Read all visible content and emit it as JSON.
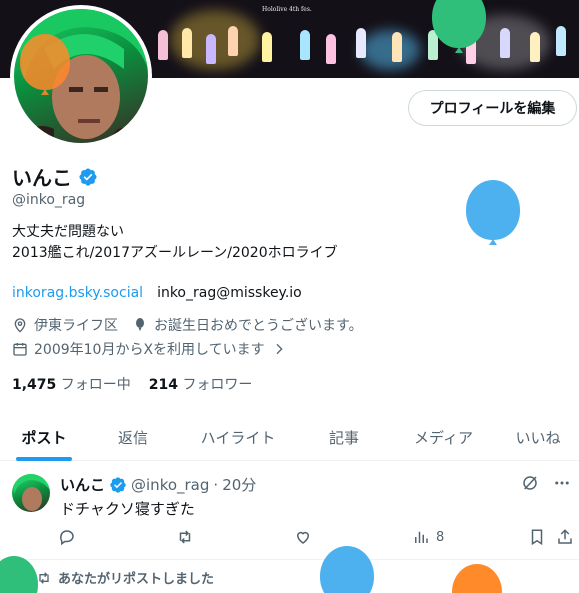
{
  "banner": {
    "logo_text": "Hololive 4th fes."
  },
  "profile": {
    "edit_button": "プロフィールを編集",
    "name": "いんこ",
    "handle": "@inko_rag",
    "bio_line1": "大丈夫だ問題ない",
    "bio_line2": "2013艦これ/2017アズールレーン/2020ホロライブ",
    "link_website": "inkorag.bsky.social",
    "link_misskey": "inko_rag@misskey.io",
    "location": "伊東ライフ区",
    "birthday": "お誕生日おめでとうございます。",
    "joined": "2009年10月からXを利用しています",
    "following_count": "1,475",
    "following_label": "フォロー中",
    "followers_count": "214",
    "followers_label": "フォロワー"
  },
  "tabs": [
    "ポスト",
    "返信",
    "ハイライト",
    "記事",
    "メディア",
    "いいね"
  ],
  "post": {
    "name": "いんこ",
    "handle": "@inko_rag",
    "dot": "·",
    "time": "20分",
    "text": "ドチャクソ寝すぎた",
    "views": "8"
  },
  "repost_note": "あなたがリポストしました",
  "colors": {
    "accent": "#1d9bf0",
    "text": "#0f1419",
    "muted": "#536471"
  },
  "icons": [
    "verified-icon",
    "location-icon",
    "balloon-icon",
    "calendar-icon",
    "chevron-right-icon",
    "reply-icon",
    "retweet-icon",
    "like-icon",
    "views-icon",
    "bookmark-icon",
    "share-icon",
    "grok-icon",
    "more-icon"
  ]
}
